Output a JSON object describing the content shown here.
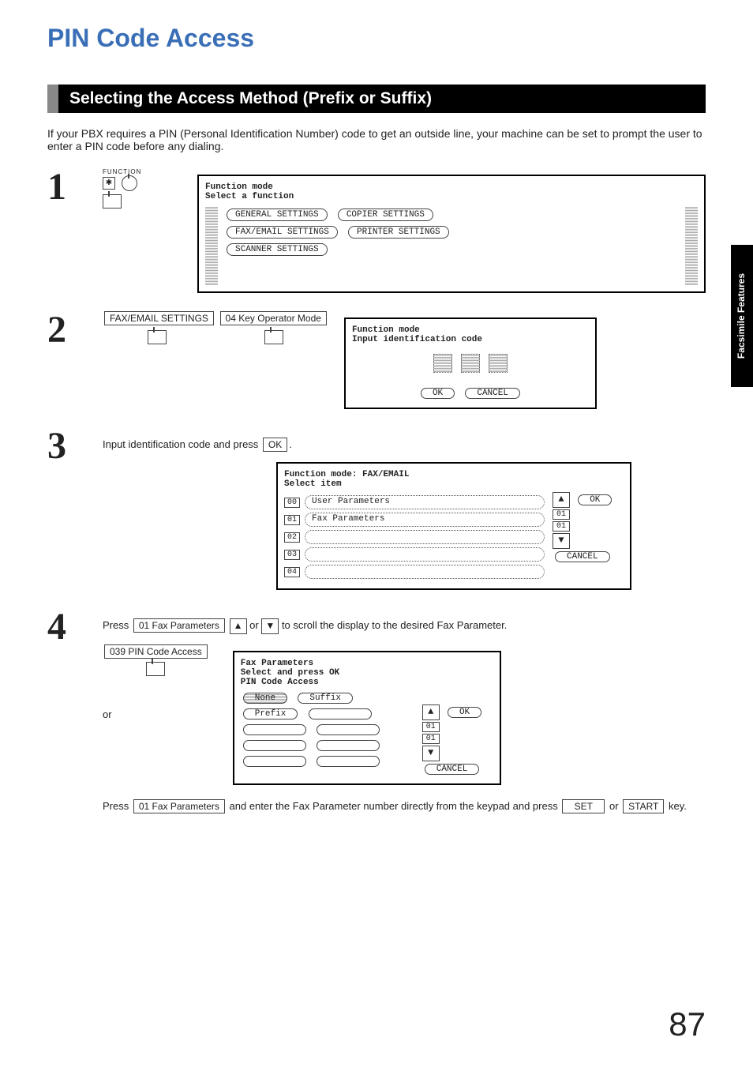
{
  "page_number": "87",
  "side_tab": "Facsimile\nFeatures",
  "title": "PIN Code Access",
  "section_heading": "Selecting the Access Method (Prefix or Suffix)",
  "intro": "If your PBX requires a PIN (Personal Identification Number) code to get an outside line, your machine can be set to prompt the user to enter a PIN code before any dialing.",
  "step1": {
    "function_label": "FUNCTION",
    "lcd_title1": "Function mode",
    "lcd_title2": "Select a function",
    "buttons": {
      "general": "GENERAL SETTINGS",
      "copier": "COPIER SETTINGS",
      "faxemail": "FAX/EMAIL SETTINGS",
      "printer": "PRINTER SETTINGS",
      "scanner": "SCANNER SETTINGS"
    }
  },
  "step2": {
    "key1": "FAX/EMAIL SETTINGS",
    "key2": "04 Key Operator Mode",
    "lcd_title1": "Function mode",
    "lcd_title2": "Input identification code",
    "ok": "OK",
    "cancel": "CANCEL"
  },
  "step3": {
    "text_a": "Input identification code and press ",
    "ok_key": "OK",
    "text_b": ".",
    "lcd_title1": "Function mode: FAX/EMAIL",
    "lcd_title2": "Select item",
    "items": {
      "i00": "00",
      "i00_label": "User Parameters",
      "i01": "01",
      "i01_label": "Fax Parameters",
      "i02": "02",
      "i03": "03",
      "i04": "04"
    },
    "scroll_label": "01",
    "ok": "OK",
    "cancel": "CANCEL"
  },
  "step4": {
    "text_a": "Press ",
    "key1": "01 Fax Parameters",
    "text_b": " ",
    "text_c": " or ",
    "text_d": " to scroll the display to the desired Fax Parameter.",
    "key2": "039 PIN Code Access",
    "or": "or",
    "text_e": "Press ",
    "key3": "01 Fax Parameters",
    "text_f": " and enter the Fax Parameter number directly from the keypad and press ",
    "set_key": "SET",
    "text_g": " or ",
    "start_key": "START",
    "text_h": " key.",
    "lcd_title1": "Fax Parameters",
    "lcd_title2": "Select and press OK",
    "lcd_title3": "PIN Code Access",
    "options": {
      "none": "None",
      "suffix": "Suffix",
      "prefix": "Prefix"
    },
    "scroll_label_top": "01",
    "scroll_label_bot": "01",
    "ok": "OK",
    "cancel": "CANCEL"
  }
}
